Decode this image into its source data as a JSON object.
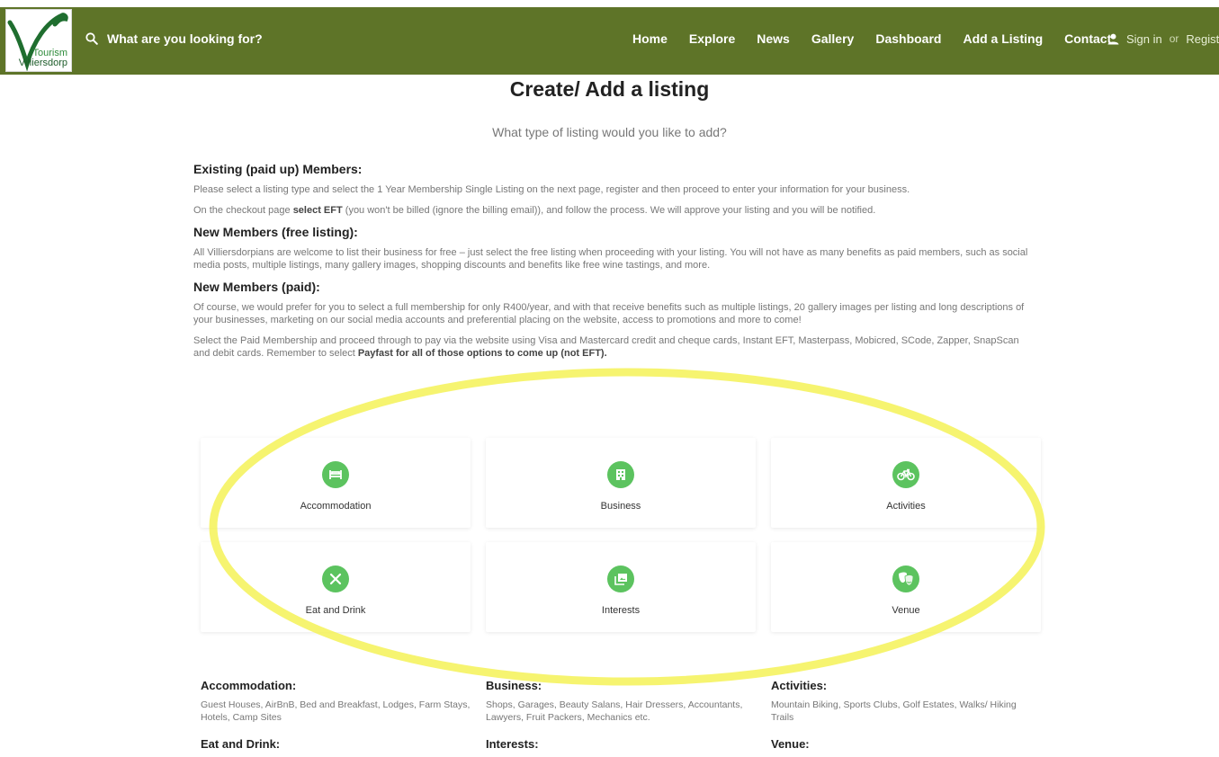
{
  "header": {
    "logo_line1": "Tourism",
    "logo_line2": "Villiersdorp",
    "search_label": "What are you looking for?",
    "nav": [
      "Home",
      "Explore",
      "News",
      "Gallery",
      "Dashboard",
      "Add a Listing",
      "Contact"
    ],
    "sign_in": "Sign in",
    "or": "or",
    "register": "Register"
  },
  "page": {
    "title": "Create/ Add a listing",
    "subtitle": "What type of listing would you like to add?"
  },
  "sections": {
    "existing_heading": "Existing (paid up) Members:",
    "existing_p1": "Please select a listing type and select the 1 Year Membership Single Listing on the next page, register and then proceed to enter your information for your business.",
    "existing_p2_pre": "On the checkout page ",
    "existing_p2_bold": "select EFT",
    "existing_p2_post": " (you won't be billed (ignore the billing email)), and follow the process. We will approve your listing and you will be notified.",
    "free_heading": "New Members (free listing):",
    "free_p1": "All Villiersdorpians are welcome to list their business for free – just select the free listing when proceeding with your listing. You will not have as many benefits as paid members, such as social media posts, multiple listings, many gallery images, shopping discounts and benefits like free wine tastings, and more.",
    "paid_heading": "New Members (paid):",
    "paid_p1": "Of course, we would prefer for you to select a full membership for only R400/year, and with that receive benefits such as multiple listings, 20 gallery images per listing and long descriptions of your businesses, marketing on our social media accounts and preferential placing on the website, access to promotions and more to come!",
    "paid_p2_pre": "Select the Paid Membership and proceed through to pay via the website using Visa and Mastercard credit and cheque cards, Instant EFT, Masterpass, Mobicred, SCode, Zapper, SnapScan and debit cards. Remember to select ",
    "paid_p2_bold": "Payfast for all of those options to come up (not EFT)."
  },
  "listing_types": [
    {
      "label": "Accommodation",
      "icon": "bed-icon"
    },
    {
      "label": "Business",
      "icon": "building-icon"
    },
    {
      "label": "Activities",
      "icon": "bicycle-icon"
    },
    {
      "label": "Eat and Drink",
      "icon": "utensils-icon"
    },
    {
      "label": "Interests",
      "icon": "photo-library-icon"
    },
    {
      "label": "Venue",
      "icon": "theater-masks-icon"
    }
  ],
  "descriptions": [
    {
      "heading": "Accommodation:",
      "text": "Guest Houses, AirBnB, Bed and Breakfast, Lodges, Farm Stays, Hotels, Camp Sites"
    },
    {
      "heading": "Business:",
      "text": "Shops, Garages, Beauty Salans, Hair Dressers, Accountants, Lawyers, Fruit Packers, Mechanics etc."
    },
    {
      "heading": "Activities:",
      "text": "Mountain Biking, Sports Clubs, Golf Estates, Walks/ Hiking Trails"
    },
    {
      "heading": "Eat and Drink:",
      "text": ""
    },
    {
      "heading": "Interests:",
      "text": ""
    },
    {
      "heading": "Venue:",
      "text": ""
    }
  ],
  "colors": {
    "header_bg": "#5e7428",
    "icon_green": "#5cc35f",
    "annotation_yellow": "#f5f257"
  }
}
